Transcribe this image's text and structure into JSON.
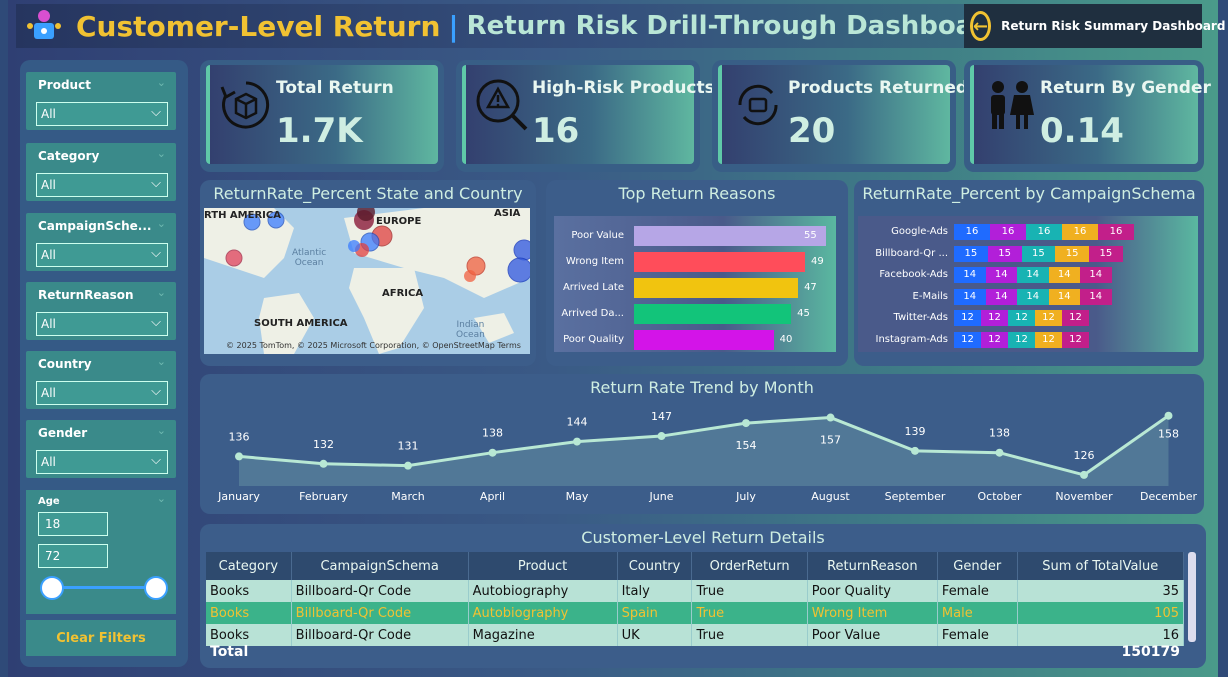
{
  "header": {
    "title_main": "Customer-Level Return",
    "separator": "|",
    "title_sub": "Return Risk Drill-Through Dashboard",
    "nav_button": "Return Risk Summary Dashboard"
  },
  "filters": [
    {
      "label": "Product",
      "value": "All"
    },
    {
      "label": "Category",
      "value": "All"
    },
    {
      "label": "CampaignSche...",
      "value": "All"
    },
    {
      "label": "ReturnReason",
      "value": "All"
    },
    {
      "label": "Country",
      "value": "All"
    },
    {
      "label": "Gender",
      "value": "All"
    }
  ],
  "age_filter": {
    "label": "Age",
    "min": "18",
    "max": "72"
  },
  "clear_button": "Clear Filters",
  "kpis": [
    {
      "title": "Total Return",
      "value": "1.7K",
      "icon": "box-return-icon"
    },
    {
      "title": "High-Risk Products",
      "value": "16",
      "icon": "warning-search-icon"
    },
    {
      "title": "Products Returned",
      "value": "20",
      "icon": "product-cycle-icon"
    },
    {
      "title": "Return By Gender",
      "value": "0.14",
      "icon": "gender-people-icon"
    }
  ],
  "map_panel": {
    "title": "ReturnRate_Percent State and Country",
    "labels": {
      "north_america": "RTH AMERICA",
      "europe": "EUROPE",
      "asia": "ASIA",
      "africa": "AFRICA",
      "south_america": "SOUTH AMERICA",
      "atlantic": "Atlantic",
      "atlantic2": "Ocean",
      "indian": "Indian",
      "indian2": "Ocean"
    },
    "footer": "© 2025 TomTom, © 2025 Microsoft Corporation, © OpenStreetMap  Terms"
  },
  "reasons_panel": {
    "title": "Top Return Reasons",
    "items": [
      {
        "label": "Poor Value",
        "value": 55,
        "color": "#b6a6e6"
      },
      {
        "label": "Wrong Item",
        "value": 49,
        "color": "#ff4d5a"
      },
      {
        "label": "Arrived Late",
        "value": 47,
        "color": "#f1c40f"
      },
      {
        "label": "Arrived Da...",
        "value": 45,
        "color": "#12c47a"
      },
      {
        "label": "Poor Quality",
        "value": 40,
        "color": "#d314e8"
      }
    ]
  },
  "campaign_panel": {
    "title": "ReturnRate_Percent by CampaignSchema",
    "colors": [
      "#1f6bff",
      "#b21fd9",
      "#18b3b3",
      "#f0b020",
      "#c21f8a"
    ],
    "rows": [
      {
        "label": "Google-Ads",
        "values": [
          16,
          16,
          16,
          16,
          16
        ]
      },
      {
        "label": "Billboard-Qr ...",
        "values": [
          15,
          15,
          15,
          15,
          15
        ]
      },
      {
        "label": "Facebook-Ads",
        "values": [
          14,
          14,
          14,
          14,
          14
        ]
      },
      {
        "label": "E-Mails",
        "values": [
          14,
          14,
          14,
          14,
          14
        ]
      },
      {
        "label": "Twitter-Ads",
        "values": [
          12,
          12,
          12,
          12,
          12
        ]
      },
      {
        "label": "Instagram-Ads",
        "values": [
          12,
          12,
          12,
          12,
          12
        ]
      }
    ]
  },
  "trend_panel": {
    "title": "Return Rate Trend by Month"
  },
  "chart_data": {
    "type": "area",
    "title": "Return Rate Trend by Month",
    "categories": [
      "January",
      "February",
      "March",
      "April",
      "May",
      "June",
      "July",
      "August",
      "September",
      "October",
      "November",
      "December"
    ],
    "values": [
      136,
      132,
      131,
      138,
      144,
      147,
      154,
      157,
      139,
      138,
      126,
      158
    ],
    "ylim": [
      120,
      160
    ]
  },
  "table": {
    "title": "Customer-Level Return Details",
    "columns": [
      "Category",
      "CampaignSchema",
      "Product",
      "Country",
      "OrderReturn",
      "ReturnReason",
      "Gender",
      "Sum of TotalValue"
    ],
    "rows": [
      [
        "Books",
        "Billboard-Qr Code",
        "Autobiography",
        "Italy",
        "True",
        "Poor Quality",
        "Female",
        "35"
      ],
      [
        "Books",
        "Billboard-Qr Code",
        "Autobiography",
        "Spain",
        "True",
        "Wrong Item",
        "Male",
        "105"
      ],
      [
        "Books",
        "Billboard-Qr Code",
        "Magazine",
        "UK",
        "True",
        "Poor Value",
        "Female",
        "16"
      ]
    ],
    "total_label": "Total",
    "total_value": "150179"
  }
}
